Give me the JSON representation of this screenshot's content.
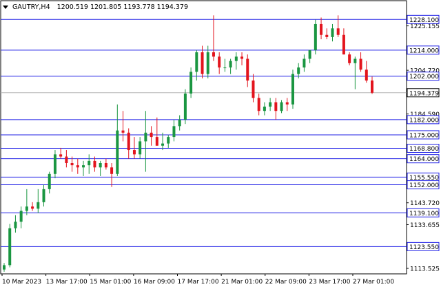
{
  "header": {
    "symbol_timeframe": "GAUTRY,H4",
    "ohlc": "1200.519 1201.805 1193.778 1194.379"
  },
  "colors": {
    "bull": "#1a9641",
    "bear": "#e3141d",
    "level_line": "#1e1ee6",
    "price_line": "#b4b4b4",
    "axis": "#000000",
    "grid_bg": "#ffffff",
    "current_price_label_bg": "#ffffff"
  },
  "axis": {
    "price_ticks": [
      "1225.155",
      "1204.720",
      "1184.590",
      "1164.000",
      "1143.720",
      "1133.655",
      "1113.525"
    ],
    "date_ticks": [
      "10 Mar 2023",
      "13 Mar 17:00",
      "15 Mar 01:00",
      "16 Mar 09:00",
      "17 Mar 17:00",
      "21 Mar 01:00",
      "22 Mar 09:00",
      "23 Mar 17:00",
      "27 Mar 01:00"
    ]
  },
  "chart_data": {
    "type": "candlestick",
    "symbol": "GAUTRY",
    "timeframe": "H4",
    "ylim": [
      1111,
      1232
    ],
    "current_price": 1194.379,
    "levels": [
      1228.1,
      1214.0,
      1202.0,
      1182.0,
      1175.0,
      1168.8,
      1164.0,
      1155.55,
      1152.0,
      1139.1,
      1123.55
    ],
    "level_labels": [
      "1228.100",
      "1214.000",
      "1202.000",
      "1182.000",
      "1175.000",
      "1168.800",
      "1164.000",
      "1155.550",
      "1152.000",
      "1139.100",
      "1123.550"
    ],
    "current_price_label": "1194.379",
    "candles": [
      {
        "o": 1113,
        "h": 1116,
        "l": 1112,
        "c": 1115
      },
      {
        "o": 1115,
        "h": 1134,
        "l": 1114,
        "c": 1132
      },
      {
        "o": 1132,
        "h": 1138,
        "l": 1130,
        "c": 1135
      },
      {
        "o": 1135,
        "h": 1142,
        "l": 1132,
        "c": 1140
      },
      {
        "o": 1140,
        "h": 1150,
        "l": 1138,
        "c": 1142
      },
      {
        "o": 1142,
        "h": 1144,
        "l": 1140,
        "c": 1141
      },
      {
        "o": 1141,
        "h": 1150,
        "l": 1139,
        "c": 1144
      },
      {
        "o": 1144,
        "h": 1152,
        "l": 1142,
        "c": 1150
      },
      {
        "o": 1150,
        "h": 1158,
        "l": 1148,
        "c": 1157
      },
      {
        "o": 1157,
        "h": 1168,
        "l": 1155,
        "c": 1166
      },
      {
        "o": 1166,
        "h": 1169,
        "l": 1164,
        "c": 1165
      },
      {
        "o": 1165,
        "h": 1168,
        "l": 1160,
        "c": 1162
      },
      {
        "o": 1162,
        "h": 1165,
        "l": 1158,
        "c": 1161
      },
      {
        "o": 1161,
        "h": 1164,
        "l": 1157,
        "c": 1160
      },
      {
        "o": 1160,
        "h": 1163,
        "l": 1156,
        "c": 1161
      },
      {
        "o": 1161,
        "h": 1166,
        "l": 1157,
        "c": 1163
      },
      {
        "o": 1163,
        "h": 1165,
        "l": 1158,
        "c": 1160
      },
      {
        "o": 1160,
        "h": 1163,
        "l": 1156,
        "c": 1162
      },
      {
        "o": 1162,
        "h": 1164,
        "l": 1159,
        "c": 1160
      },
      {
        "o": 1160,
        "h": 1162,
        "l": 1151,
        "c": 1157
      },
      {
        "o": 1157,
        "h": 1189,
        "l": 1156,
        "c": 1177
      },
      {
        "o": 1177,
        "h": 1186,
        "l": 1172,
        "c": 1176
      },
      {
        "o": 1176,
        "h": 1178,
        "l": 1164,
        "c": 1168
      },
      {
        "o": 1168,
        "h": 1174,
        "l": 1164,
        "c": 1166
      },
      {
        "o": 1166,
        "h": 1174,
        "l": 1164,
        "c": 1172
      },
      {
        "o": 1172,
        "h": 1186,
        "l": 1158,
        "c": 1176
      },
      {
        "o": 1176,
        "h": 1179,
        "l": 1170,
        "c": 1174
      },
      {
        "o": 1174,
        "h": 1183,
        "l": 1170,
        "c": 1170
      },
      {
        "o": 1170,
        "h": 1176,
        "l": 1168,
        "c": 1171
      },
      {
        "o": 1171,
        "h": 1175,
        "l": 1169,
        "c": 1174
      },
      {
        "o": 1174,
        "h": 1182,
        "l": 1172,
        "c": 1179
      },
      {
        "o": 1179,
        "h": 1184,
        "l": 1177,
        "c": 1182
      },
      {
        "o": 1182,
        "h": 1196,
        "l": 1180,
        "c": 1194
      },
      {
        "o": 1194,
        "h": 1206,
        "l": 1192,
        "c": 1204
      },
      {
        "o": 1204,
        "h": 1214,
        "l": 1200,
        "c": 1213
      },
      {
        "o": 1213,
        "h": 1216,
        "l": 1201,
        "c": 1203
      },
      {
        "o": 1203,
        "h": 1216,
        "l": 1201,
        "c": 1213
      },
      {
        "o": 1213,
        "h": 1230,
        "l": 1209,
        "c": 1211
      },
      {
        "o": 1211,
        "h": 1213,
        "l": 1203,
        "c": 1206
      },
      {
        "o": 1206,
        "h": 1210,
        "l": 1204,
        "c": 1206
      },
      {
        "o": 1206,
        "h": 1210,
        "l": 1203,
        "c": 1209
      },
      {
        "o": 1209,
        "h": 1213,
        "l": 1205,
        "c": 1211
      },
      {
        "o": 1211,
        "h": 1213,
        "l": 1207,
        "c": 1210
      },
      {
        "o": 1210,
        "h": 1212,
        "l": 1197,
        "c": 1200
      },
      {
        "o": 1200,
        "h": 1203,
        "l": 1190,
        "c": 1192
      },
      {
        "o": 1192,
        "h": 1194,
        "l": 1184,
        "c": 1186
      },
      {
        "o": 1186,
        "h": 1190,
        "l": 1184,
        "c": 1188
      },
      {
        "o": 1188,
        "h": 1192,
        "l": 1186,
        "c": 1190
      },
      {
        "o": 1190,
        "h": 1192,
        "l": 1182,
        "c": 1186
      },
      {
        "o": 1186,
        "h": 1191,
        "l": 1185,
        "c": 1190
      },
      {
        "o": 1190,
        "h": 1192,
        "l": 1186,
        "c": 1189
      },
      {
        "o": 1189,
        "h": 1205,
        "l": 1187,
        "c": 1203
      },
      {
        "o": 1203,
        "h": 1208,
        "l": 1201,
        "c": 1206
      },
      {
        "o": 1206,
        "h": 1212,
        "l": 1204,
        "c": 1210
      },
      {
        "o": 1210,
        "h": 1214,
        "l": 1208,
        "c": 1214
      },
      {
        "o": 1214,
        "h": 1228,
        "l": 1212,
        "c": 1226
      },
      {
        "o": 1226,
        "h": 1229,
        "l": 1219,
        "c": 1221
      },
      {
        "o": 1221,
        "h": 1224,
        "l": 1219,
        "c": 1220
      },
      {
        "o": 1220,
        "h": 1226,
        "l": 1218,
        "c": 1224
      },
      {
        "o": 1224,
        "h": 1230,
        "l": 1220,
        "c": 1221
      },
      {
        "o": 1221,
        "h": 1224,
        "l": 1212,
        "c": 1212
      },
      {
        "o": 1212,
        "h": 1213,
        "l": 1207,
        "c": 1208
      },
      {
        "o": 1208,
        "h": 1211,
        "l": 1196,
        "c": 1210
      },
      {
        "o": 1210,
        "h": 1213,
        "l": 1204,
        "c": 1205
      },
      {
        "o": 1205,
        "h": 1209,
        "l": 1199,
        "c": 1200
      },
      {
        "o": 1200,
        "h": 1201.805,
        "l": 1193.778,
        "c": 1194.379
      }
    ]
  }
}
